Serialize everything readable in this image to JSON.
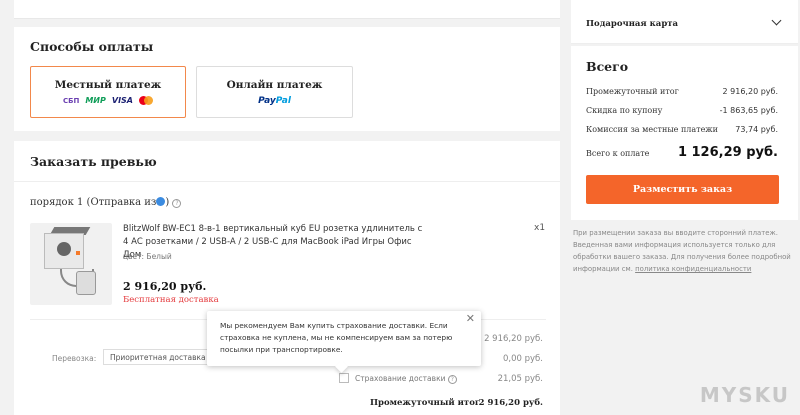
{
  "payment": {
    "title": "Способы оплаты",
    "options": [
      {
        "title": "Местный платеж",
        "logos": [
          "СБП",
          "МИР",
          "VISA"
        ]
      },
      {
        "title": "Онлайн платеж",
        "logos": [
          "Pay",
          "Pal"
        ]
      }
    ]
  },
  "order": {
    "title": "Заказать превью",
    "order_label": "порядок 1 (Отправка из",
    "order_label_end": ")",
    "product": {
      "title": "BlitzWolf BW-EC1 8-в-1 вертикальный куб EU розетка удлинитель с 4 АС розетками / 2 USB-A / 2 USB-C для MacBook iPad Игры Офис Дом",
      "qty": "x1",
      "color": "цвет: Белый",
      "price": "2 916,20 руб.",
      "shipping_note": "Бесплатная доставка"
    },
    "summary": {
      "items_value": "2 916,20 руб.",
      "shipping_label": "Перевозка:",
      "shipping_select": "Приоритетная доставка Banggood",
      "shipping_value": "0,00 руб.",
      "insurance_label": "Страхование доставки",
      "insurance_value": "21,05 руб.",
      "subtotal_label": "Промежуточный итог",
      "subtotal_value": "2 916,20 руб."
    },
    "tooltip": "Мы рекомендуем Вам купить страхование доставки. Если страховка не куплена, мы не компенсируем вам за потерю посылки при транспортировке."
  },
  "sidebar": {
    "gift_card": "Подарочная карта",
    "total_title": "Всего",
    "rows": [
      {
        "label": "Промежуточный итог",
        "value": "2 916,20 руб."
      },
      {
        "label": "Скидка по купону",
        "value": "-1 863,65 руб."
      },
      {
        "label": "Комиссия за местные платежи",
        "value": "73,74 руб."
      }
    ],
    "grand_label": "Всего к оплате",
    "grand_value": "1 126,29 руб.",
    "place_order": "Разместить заказ",
    "note": "При размещении заказа вы вводите сторонний платеж. Введенная вами информация используется только для обработки вашего заказа. Для получения более подробной информации см.",
    "policy_link": "политика конфиденциальности"
  },
  "watermark": "MYSKU"
}
